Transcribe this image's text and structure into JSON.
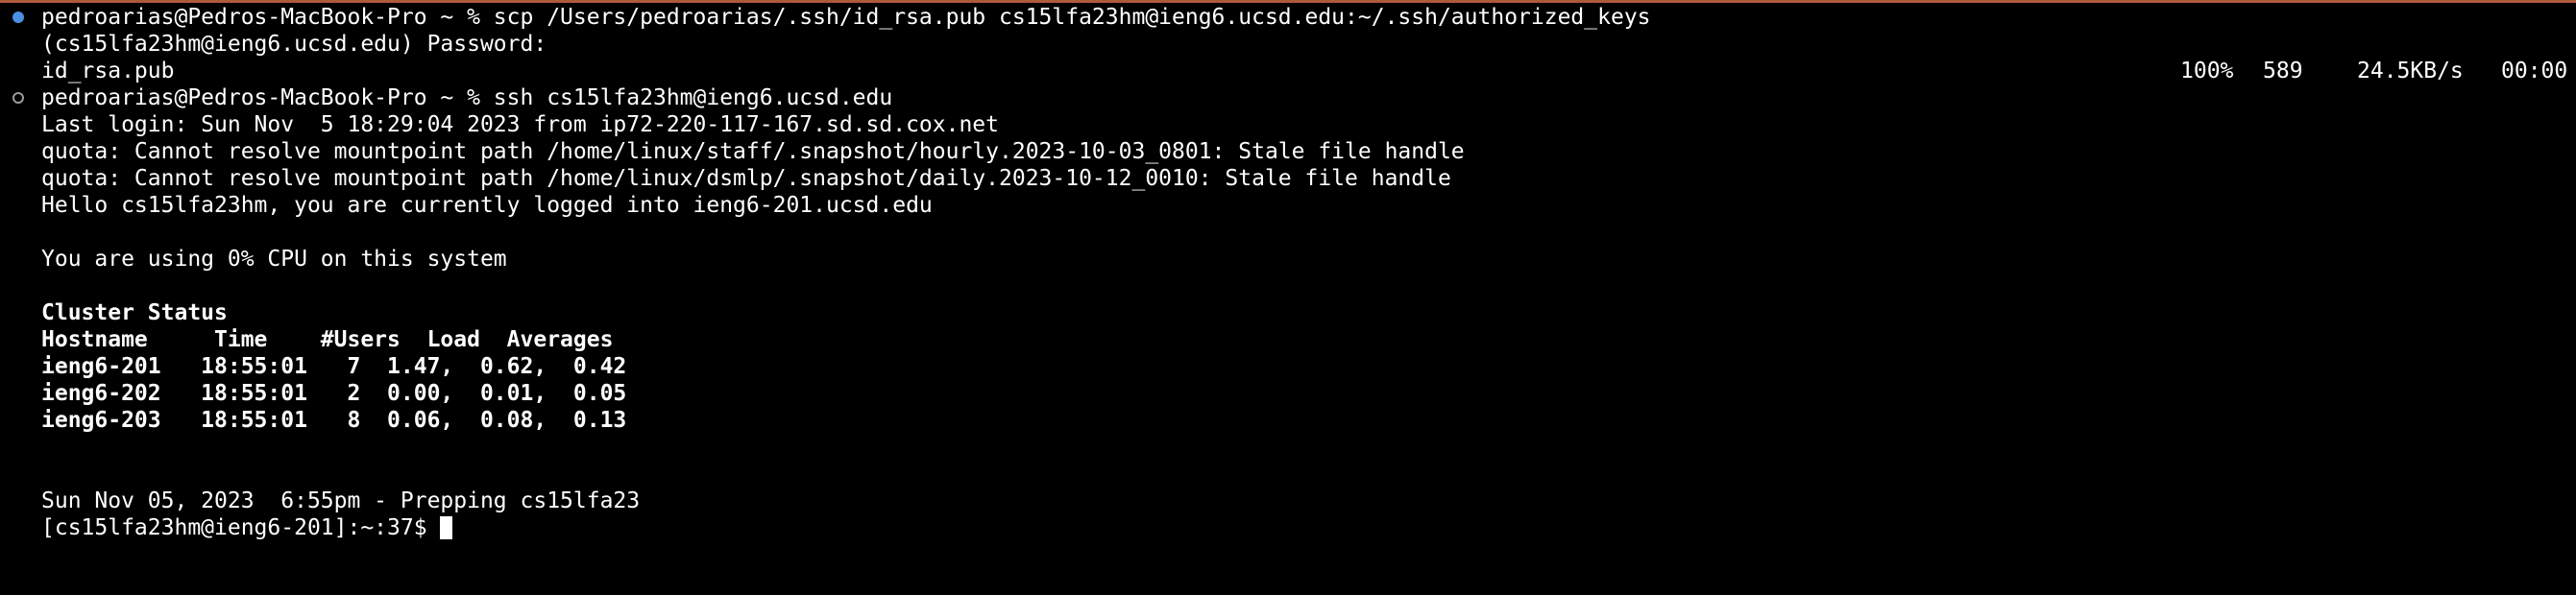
{
  "colors": {
    "background": "#000000",
    "foreground": "#ffffff",
    "top_border": "#b05a3c",
    "active_mark": "#4a90e2",
    "inactive_mark": "#9a9a9a"
  },
  "scp": {
    "command": "pedroarias@Pedros-MacBook-Pro ~ % scp /Users/pedroarias/.ssh/id_rsa.pub cs15lfa23hm@ieng6.ucsd.edu:~/.ssh/authorized_keys",
    "password_prompt": "(cs15lfa23hm@ieng6.ucsd.edu) Password:",
    "file": "id_rsa.pub",
    "percent": "100%",
    "size": "589",
    "rate": "24.5KB/s",
    "eta": "00:00"
  },
  "ssh": {
    "command": "pedroarias@Pedros-MacBook-Pro ~ % ssh cs15lfa23hm@ieng6.ucsd.edu",
    "last_login": "Last login: Sun Nov  5 18:29:04 2023 from ip72-220-117-167.sd.sd.cox.net",
    "quota_1": "quota: Cannot resolve mountpoint path /home/linux/staff/.snapshot/hourly.2023-10-03_0801: Stale file handle",
    "quota_2": "quota: Cannot resolve mountpoint path /home/linux/dsmlp/.snapshot/daily.2023-10-12_0010: Stale file handle",
    "hello": "Hello cs15lfa23hm, you are currently logged into ieng6-201.ucsd.edu",
    "cpu": "You are using 0% CPU on this system"
  },
  "cluster": {
    "title": "Cluster Status",
    "header": "Hostname     Time    #Users  Load  Averages",
    "rows": [
      "ieng6-201   18:55:01   7  1.47,  0.62,  0.42",
      "ieng6-202   18:55:01   2  0.00,  0.01,  0.05",
      "ieng6-203   18:55:01   8  0.06,  0.08,  0.13"
    ]
  },
  "footer": {
    "date_line": "Sun Nov 05, 2023  6:55pm - Prepping cs15lfa23",
    "prompt": "[cs15lfa23hm@ieng6-201]:~:37$ "
  }
}
